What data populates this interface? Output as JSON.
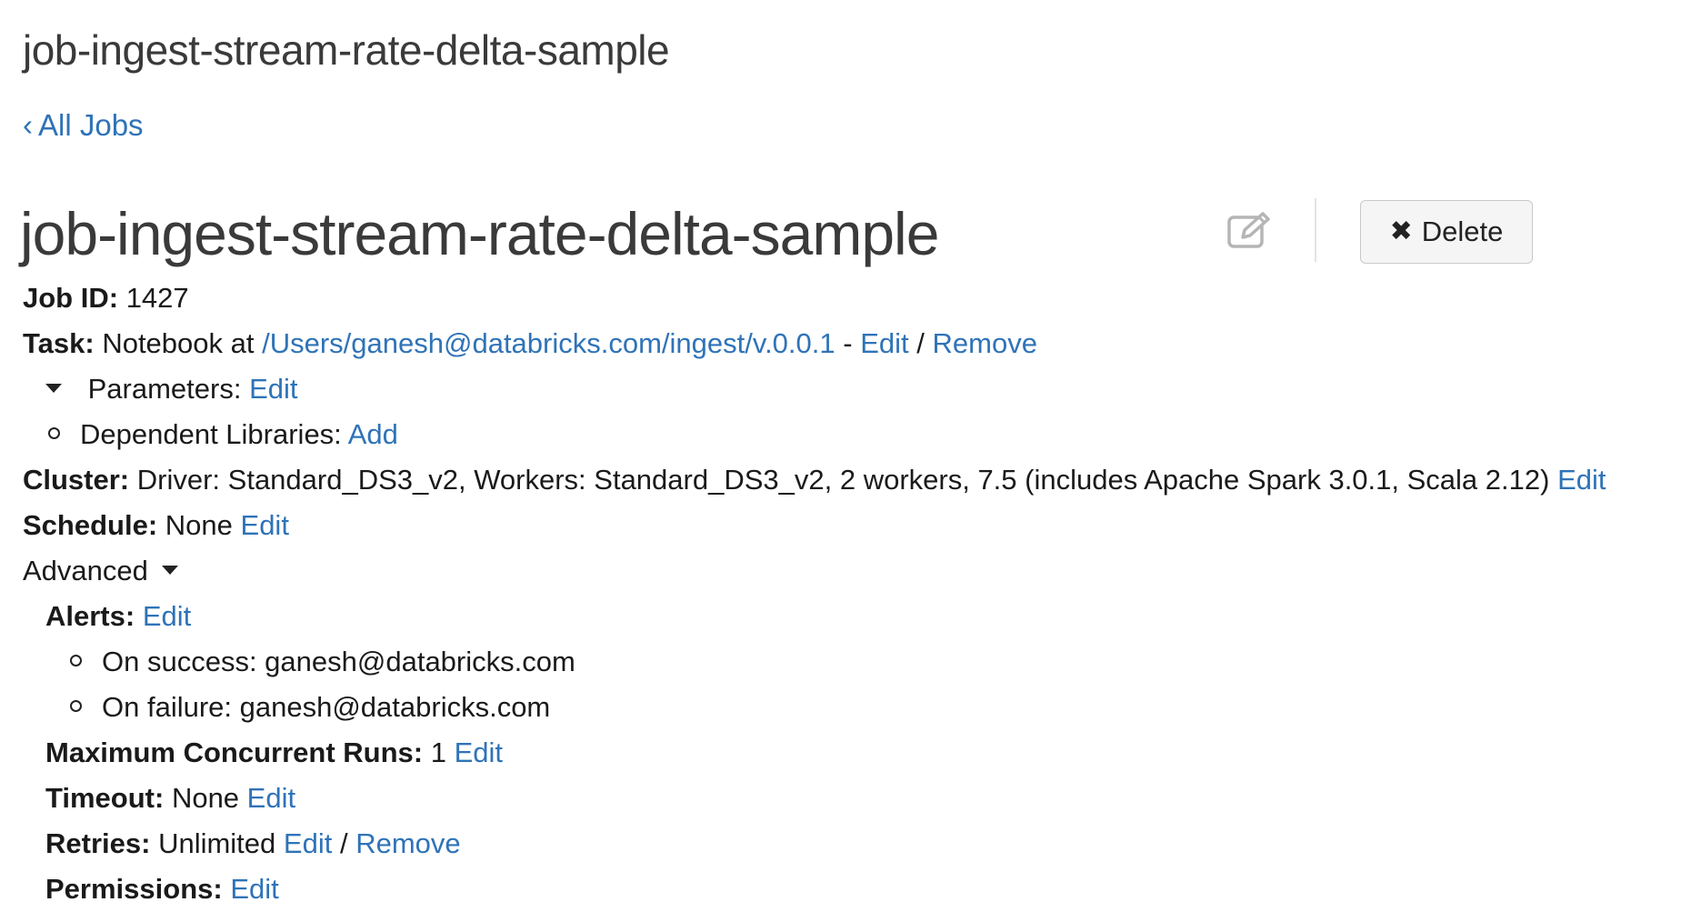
{
  "header": {
    "top_title": "job-ingest-stream-rate-delta-sample",
    "back_link": "All Jobs",
    "job_title": "job-ingest-stream-rate-delta-sample",
    "delete_label": "Delete"
  },
  "job": {
    "job_id_label": "Job ID:",
    "job_id_value": "1427",
    "task_label": "Task:",
    "task_prefix": "Notebook at",
    "task_path": "/Users/ganesh@databricks.com/ingest/v.0.0.1",
    "task_sep": "-",
    "task_edit": "Edit",
    "task_slash": "/",
    "task_remove": "Remove",
    "parameters_label": "Parameters:",
    "parameters_edit": "Edit",
    "dependent_label": "Dependent Libraries:",
    "dependent_add": "Add",
    "cluster_label": "Cluster:",
    "cluster_value": "Driver: Standard_DS3_v2, Workers: Standard_DS3_v2, 2 workers, 7.5 (includes Apache Spark 3.0.1, Scala 2.12)",
    "cluster_edit": "Edit",
    "schedule_label": "Schedule:",
    "schedule_value": "None",
    "schedule_edit": "Edit",
    "advanced_label": "Advanced"
  },
  "advanced": {
    "alerts_label": "Alerts:",
    "alerts_edit": "Edit",
    "on_success": "On success: ganesh@databricks.com",
    "on_failure": "On failure: ganesh@databricks.com",
    "max_runs_label": "Maximum Concurrent Runs:",
    "max_runs_value": "1",
    "max_runs_edit": "Edit",
    "timeout_label": "Timeout:",
    "timeout_value": "None",
    "timeout_edit": "Edit",
    "retries_label": "Retries:",
    "retries_value": "Unlimited",
    "retries_edit": "Edit",
    "retries_slash": "/",
    "retries_remove": "Remove",
    "permissions_label": "Permissions:",
    "permissions_edit": "Edit"
  },
  "colors": {
    "link": "#2f73b8",
    "title": "#3a3a3a",
    "text": "#1a1a1a"
  },
  "icons": {
    "edit": "pencil-square-icon",
    "delete": "close-icon",
    "back": "chevron-left-icon"
  }
}
